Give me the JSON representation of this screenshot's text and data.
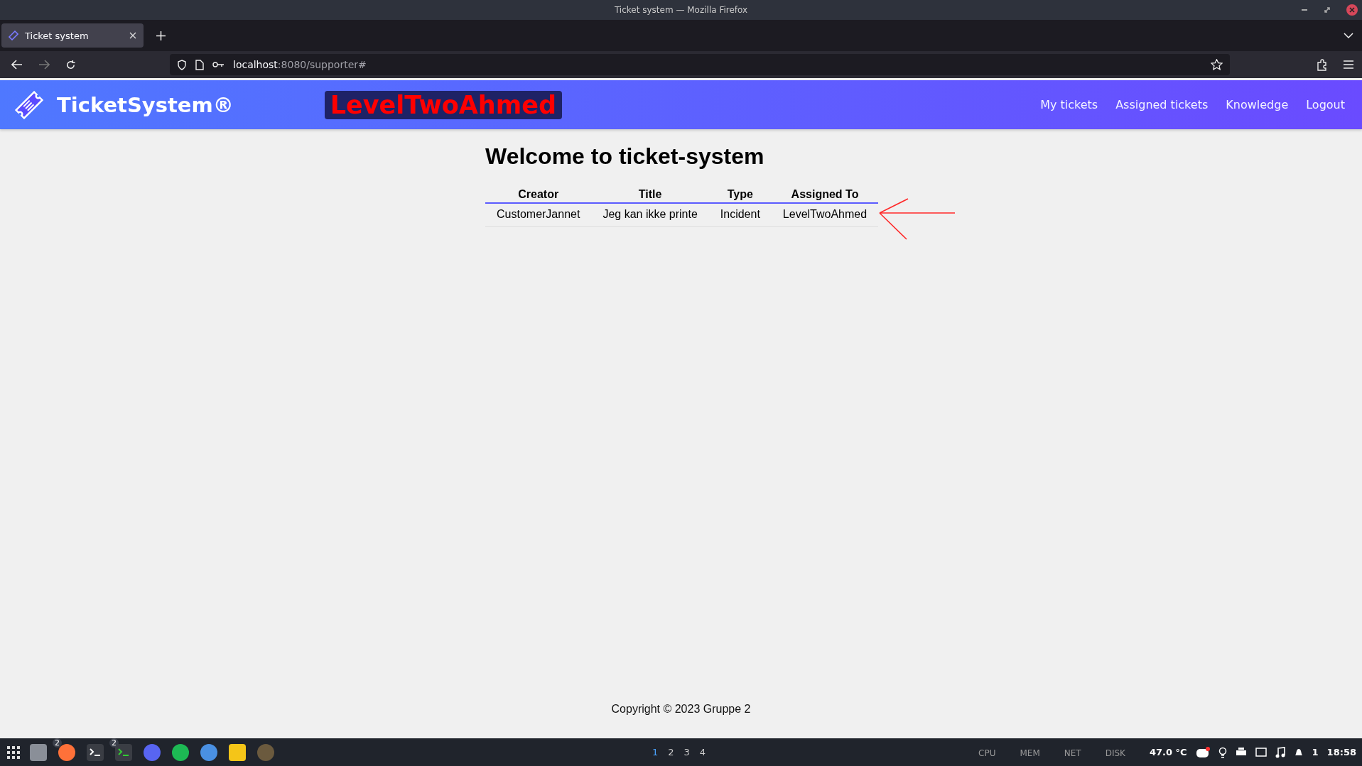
{
  "window": {
    "title": "Ticket system — Mozilla Firefox"
  },
  "tabs": [
    {
      "label": "Ticket system",
      "selected": true
    }
  ],
  "address_bar": {
    "host": "localhost",
    "path": ":8080/supporter#"
  },
  "header": {
    "brand": "TicketSystem®",
    "user": "LevelTwoAhmed",
    "nav": [
      "My tickets",
      "Assigned tickets",
      "Knowledge",
      "Logout"
    ]
  },
  "page": {
    "heading": "Welcome to ticket-system",
    "table": {
      "columns": [
        "Creator",
        "Title",
        "Type",
        "Assigned To"
      ],
      "rows": [
        [
          "CustomerJannet",
          "Jeg kan ikke printe",
          "Incident",
          "LevelTwoAhmed"
        ]
      ]
    },
    "footer": "Copyright © 2023 Gruppe 2"
  },
  "taskbar": {
    "apps": [
      {
        "kind": "files"
      },
      {
        "kind": "firefox",
        "badge": "2"
      },
      {
        "kind": "terminal"
      },
      {
        "kind": "terminal-green",
        "badge": "2"
      },
      {
        "kind": "discord"
      },
      {
        "kind": "spotify"
      },
      {
        "kind": "chrome"
      },
      {
        "kind": "draw"
      },
      {
        "kind": "gimp"
      }
    ],
    "workspaces": [
      {
        "label": "1",
        "selected": true
      },
      {
        "label": "2",
        "selected": false
      },
      {
        "label": "3",
        "selected": false
      },
      {
        "label": "4",
        "selected": false
      }
    ],
    "monitors": [
      "CPU",
      "MEM",
      "NET",
      "DISK"
    ],
    "temperature": "47.0 °C",
    "notifications": "1",
    "time": "18:58"
  }
}
